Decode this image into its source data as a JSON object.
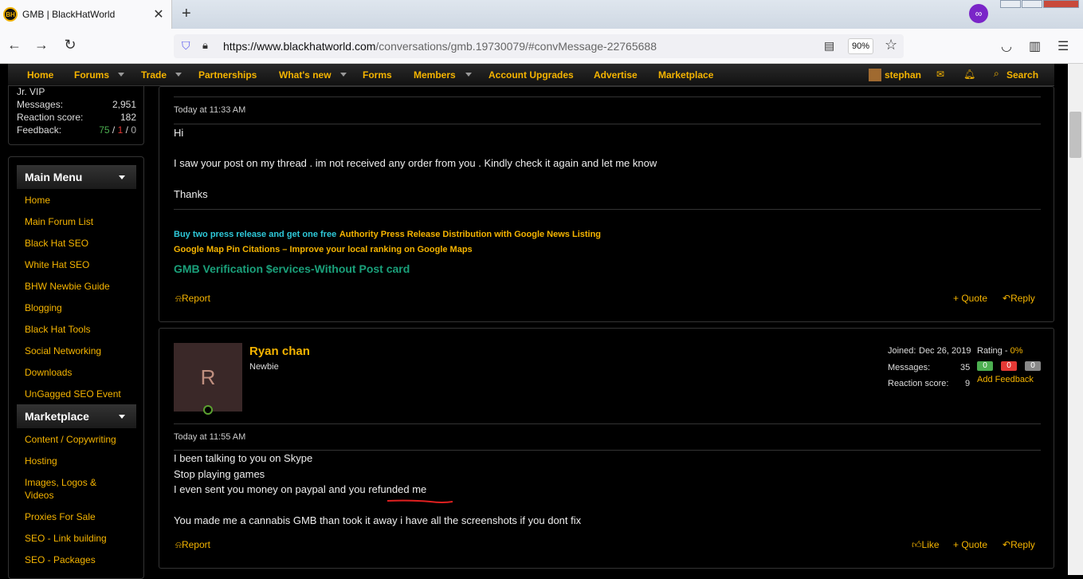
{
  "browser": {
    "tab_title": "GMB | BlackHatWorld",
    "tab_close": "✕",
    "new_tab": "+",
    "url_host": "https://www.blackhatworld.com",
    "url_path": "/conversations/gmb.19730079/#convMessage-22765688",
    "zoom": "90%"
  },
  "nav": {
    "items": [
      "Home",
      "Forums",
      "Trade",
      "Partnerships",
      "What's new",
      "Forms",
      "Members",
      "Account Upgrades",
      "Advertise",
      "Marketplace"
    ],
    "user": "stephan",
    "search": "Search"
  },
  "profile": {
    "rank": "Jr. VIP",
    "messages_label": "Messages:",
    "messages": "2,951",
    "reaction_label": "Reaction score:",
    "reaction": "182",
    "feedback_label": "Feedback:",
    "fb_pos": "75",
    "fb_sep1": " / ",
    "fb_neg": "1",
    "fb_sep2": " / ",
    "fb_neu": "0"
  },
  "sidebar": {
    "main_menu": "Main Menu",
    "main_items": [
      "Home",
      "Main Forum List",
      "Black Hat SEO",
      "White Hat SEO",
      "BHW Newbie Guide",
      "Blogging",
      "Black Hat Tools",
      "Social Networking",
      "Downloads",
      "UnGagged SEO Event"
    ],
    "marketplace": "Marketplace",
    "market_items": [
      "Content / Copywriting",
      "Hosting",
      "Images, Logos & Videos",
      "Proxies For Sale",
      "SEO - Link building",
      "SEO - Packages"
    ]
  },
  "post1": {
    "time": "Today at 11:33 AM",
    "lines": [
      "Hi",
      "I saw your post on my thread . im not received any order from you . Kindly check it again and let me know",
      "Thanks"
    ],
    "sig1_cyan": "Buy two press release and get one free",
    "sig1_yellow": "Authority Press Release Distribution with Google News Listing",
    "sig2": "Google Map Pin Citations – Improve your local ranking on Google Maps",
    "sig3": "GMB Verification $ervices-Without Post card",
    "report": "Report",
    "quote": "+ Quote",
    "reply": "Reply"
  },
  "post2": {
    "avatar_letter": "R",
    "username": "Ryan chan",
    "user_title": "Newbie",
    "joined_label": "Joined:",
    "joined": "Dec 26, 2019",
    "messages_label": "Messages:",
    "messages": "35",
    "reaction_label": "Reaction score:",
    "reaction": "9",
    "rating_label": "Rating - ",
    "rating": "0%",
    "fb_pos": "0",
    "fb_neg": "0",
    "fb_neu": "0",
    "add_feedback": "Add Feedback",
    "time": "Today at 11:55 AM",
    "lines": [
      "I been talking to you on Skype",
      "Stop playing games",
      "I even sent you money on paypal and you refunded me",
      "You made me a cannabis GMB than took it away i have all the screenshots if you dont fix"
    ],
    "report": "Report",
    "like": "Like",
    "quote": "+ Quote",
    "reply": "Reply"
  },
  "colors": {
    "accent": "#f5b400",
    "cyan": "#2ec8d8",
    "green": "#1aa07a",
    "annotation": "#e02020"
  }
}
